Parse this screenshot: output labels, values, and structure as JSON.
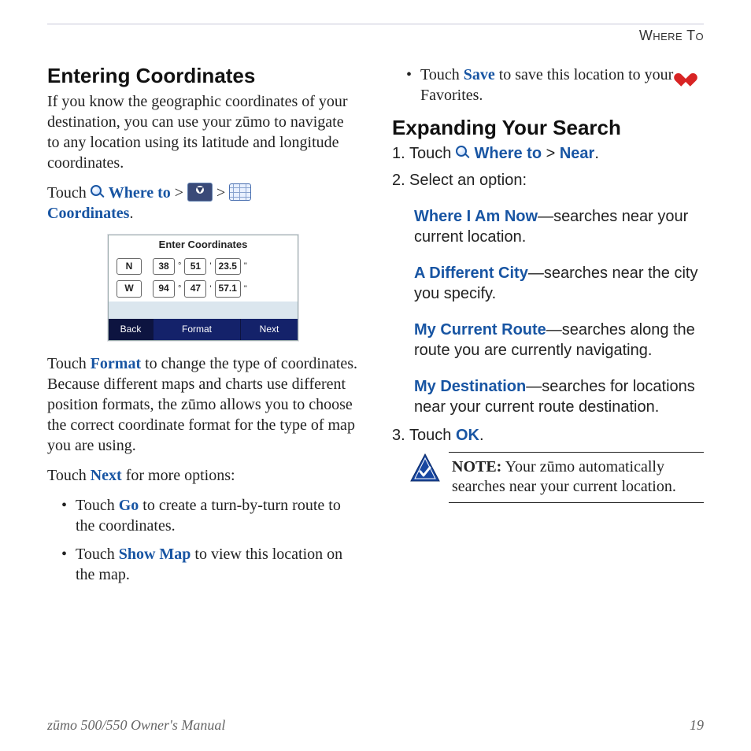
{
  "header": {
    "section": "Where To"
  },
  "left": {
    "h1": "Entering Coordinates",
    "intro": "If you know the geographic coordinates of your destination, you can use your zūmo to navigate to any location using its latitude and longitude coordinates.",
    "touch_prefix": "Touch ",
    "where_to": "Where to",
    "coords_label": "Coordinates",
    "device": {
      "title": "Enter Coordinates",
      "rows": [
        {
          "dir": "N",
          "d": "38",
          "m": "51",
          "s": "23.5"
        },
        {
          "dir": "W",
          "d": "94",
          "m": "47",
          "s": "57.1"
        }
      ],
      "deg": "°",
      "min": "'",
      "sec": "\"",
      "back": "Back",
      "format": "Format",
      "next": "Next"
    },
    "format_label": "Format",
    "format_para_pre": "Touch ",
    "format_para_post": " to change the type of coordinates. Because different maps and charts use different position formats, the zūmo allows you to choose the correct coordinate format for the type of map you are using.",
    "next_label": "Next",
    "next_para_pre": "Touch ",
    "next_para_post": " for more options:",
    "go_label": "Go",
    "bullet_go_pre": "Touch ",
    "bullet_go_post": " to create a turn-by-turn route to the coordinates.",
    "showmap_label": "Show Map",
    "bullet_show_pre": "Touch ",
    "bullet_show_post": " to view this location on the map."
  },
  "right": {
    "save_label": "Save",
    "bullet_save_pre": "Touch ",
    "bullet_save_mid": " to save this location to your ",
    "bullet_save_post": " Favorites.",
    "h2": "Expanding Your Search",
    "steps": {
      "s1_pre": "Touch ",
      "s1_where": "Where to",
      "s1_gt": " > ",
      "s1_near": "Near",
      "s1_post": ".",
      "s2": "Select an option:",
      "opt1_label": "Where I Am Now",
      "opt1_text": "—searches near your current location.",
      "opt2_label": "A Different City",
      "opt2_text": "—searches near the city you specify.",
      "opt3_label": "My Current Route",
      "opt3_text": "—searches along the route you are currently navigating.",
      "opt4_label": "My Destination",
      "opt4_text": "—searches for locations near your current route destination.",
      "s3_pre": "Touch ",
      "s3_ok": "OK",
      "s3_post": "."
    },
    "note_label": "NOTE:",
    "note_text": " Your zūmo automatically searches near your current location."
  },
  "footer": {
    "left": "zūmo 500/550 Owner's Manual",
    "right": "19"
  }
}
